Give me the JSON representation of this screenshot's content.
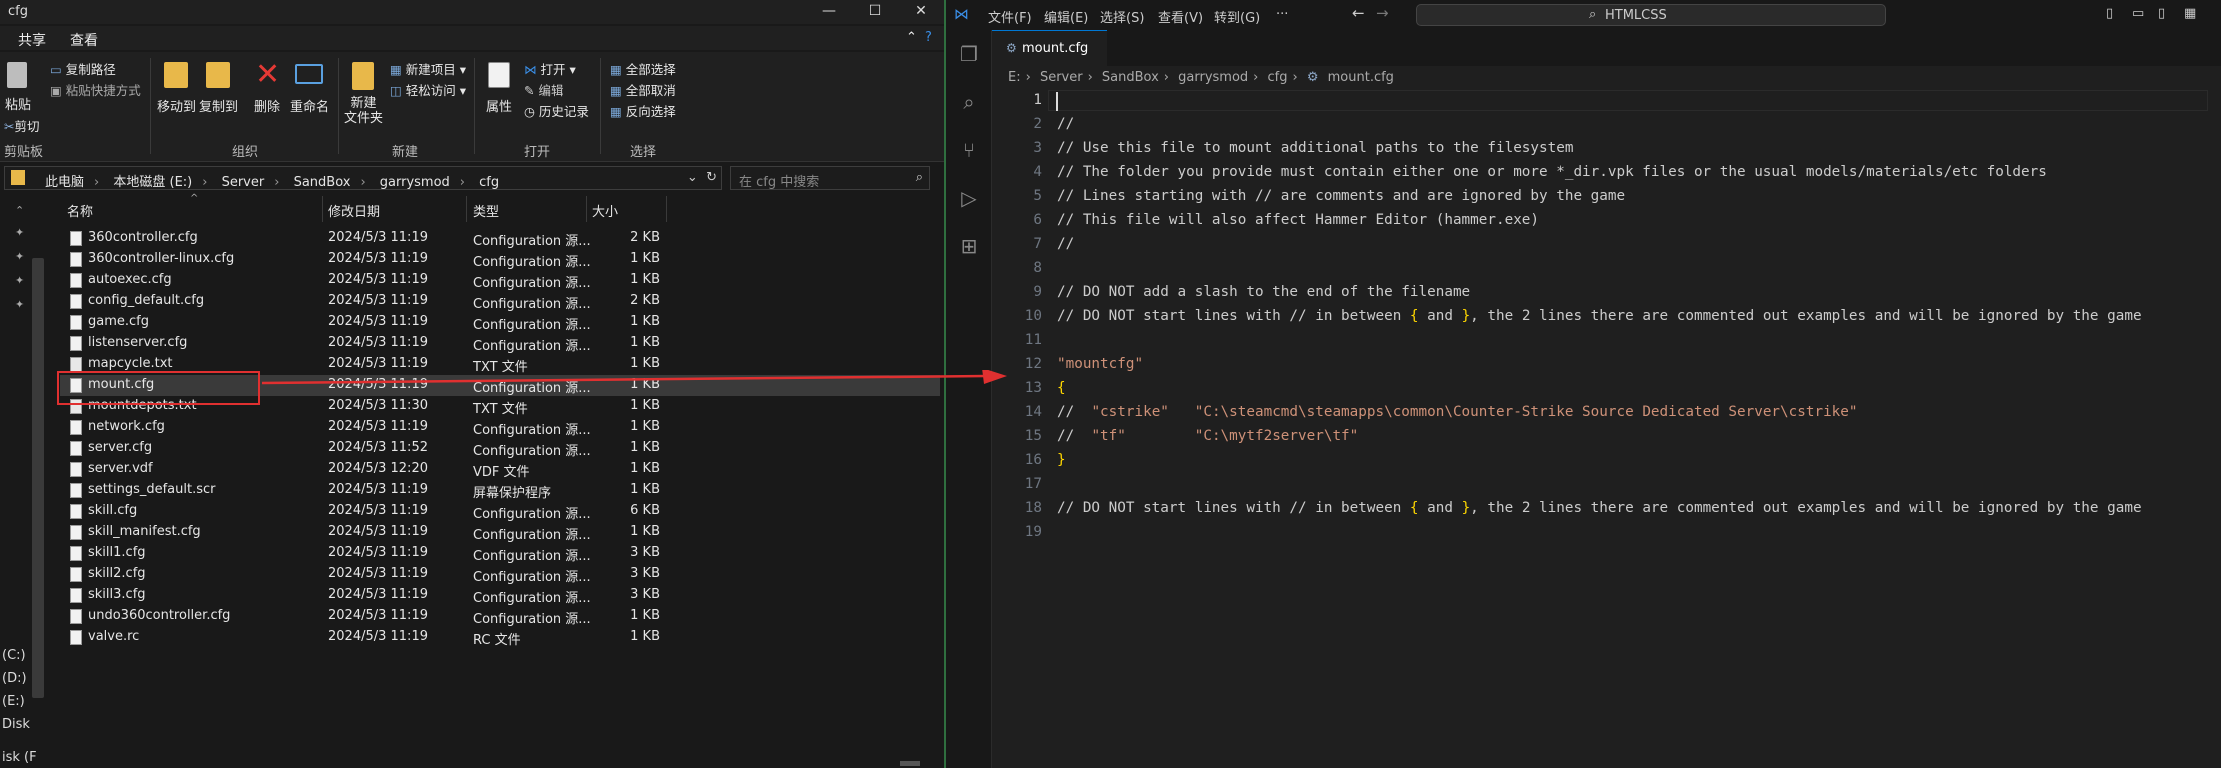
{
  "explorer": {
    "window_title": "cfg",
    "window_buttons": [
      "—",
      "☐",
      "✕"
    ],
    "ribbon_tabs": [
      "共享",
      "查看"
    ],
    "ribbon": {
      "clipboard": {
        "paste": "粘贴",
        "copy_path": "复制路径",
        "paste_shortcut": "粘贴快捷方式",
        "cut": "剪切",
        "group": "剪贴板"
      },
      "organize": {
        "move_to": "移动到",
        "copy_to": "复制到",
        "delete": "删除",
        "rename": "重命名",
        "group": "组织"
      },
      "new": {
        "new_folder": "新建\n文件夹",
        "new_item": "新建项目",
        "easy_access": "轻松访问",
        "group": "新建"
      },
      "open": {
        "properties": "属性",
        "open": "打开",
        "edit": "编辑",
        "history": "历史记录",
        "group": "打开"
      },
      "select": {
        "select_all": "全部选择",
        "select_none": "全部取消",
        "invert": "反向选择",
        "group": "选择"
      }
    },
    "address": {
      "crumbs": [
        "此电脑",
        "本地磁盘 (E:)",
        "Server",
        "SandBox",
        "garrysmod",
        "cfg"
      ],
      "search_placeholder": "在 cfg 中搜索"
    },
    "nav_drives": [
      "(C:)",
      "(D:)",
      "(E:)",
      "Disk",
      "isk (F"
    ],
    "columns": {
      "name": "名称",
      "date": "修改日期",
      "type": "类型",
      "size": "大小"
    },
    "files": [
      {
        "name": "360controller.cfg",
        "date": "2024/5/3 11:19",
        "type": "Configuration 源...",
        "size": "2 KB"
      },
      {
        "name": "360controller-linux.cfg",
        "date": "2024/5/3 11:19",
        "type": "Configuration 源...",
        "size": "1 KB"
      },
      {
        "name": "autoexec.cfg",
        "date": "2024/5/3 11:19",
        "type": "Configuration 源...",
        "size": "1 KB"
      },
      {
        "name": "config_default.cfg",
        "date": "2024/5/3 11:19",
        "type": "Configuration 源...",
        "size": "2 KB"
      },
      {
        "name": "game.cfg",
        "date": "2024/5/3 11:19",
        "type": "Configuration 源...",
        "size": "1 KB"
      },
      {
        "name": "listenserver.cfg",
        "date": "2024/5/3 11:19",
        "type": "Configuration 源...",
        "size": "1 KB"
      },
      {
        "name": "mapcycle.txt",
        "date": "2024/5/3 11:19",
        "type": "TXT 文件",
        "size": "1 KB"
      },
      {
        "name": "mount.cfg",
        "date": "2024/5/3 11:19",
        "type": "Configuration 源...",
        "size": "1 KB"
      },
      {
        "name": "mountdepots.txt",
        "date": "2024/5/3 11:30",
        "type": "TXT 文件",
        "size": "1 KB"
      },
      {
        "name": "network.cfg",
        "date": "2024/5/3 11:19",
        "type": "Configuration 源...",
        "size": "1 KB"
      },
      {
        "name": "server.cfg",
        "date": "2024/5/3 11:52",
        "type": "Configuration 源...",
        "size": "1 KB"
      },
      {
        "name": "server.vdf",
        "date": "2024/5/3 12:20",
        "type": "VDF 文件",
        "size": "1 KB"
      },
      {
        "name": "settings_default.scr",
        "date": "2024/5/3 11:19",
        "type": "屏幕保护程序",
        "size": "1 KB"
      },
      {
        "name": "skill.cfg",
        "date": "2024/5/3 11:19",
        "type": "Configuration 源...",
        "size": "6 KB"
      },
      {
        "name": "skill_manifest.cfg",
        "date": "2024/5/3 11:19",
        "type": "Configuration 源...",
        "size": "1 KB"
      },
      {
        "name": "skill1.cfg",
        "date": "2024/5/3 11:19",
        "type": "Configuration 源...",
        "size": "3 KB"
      },
      {
        "name": "skill2.cfg",
        "date": "2024/5/3 11:19",
        "type": "Configuration 源...",
        "size": "3 KB"
      },
      {
        "name": "skill3.cfg",
        "date": "2024/5/3 11:19",
        "type": "Configuration 源...",
        "size": "3 KB"
      },
      {
        "name": "undo360controller.cfg",
        "date": "2024/5/3 11:19",
        "type": "Configuration 源...",
        "size": "1 KB"
      },
      {
        "name": "valve.rc",
        "date": "2024/5/3 11:19",
        "type": "RC 文件",
        "size": "1 KB"
      }
    ],
    "highlight_color": "#e03030"
  },
  "vscode": {
    "menus": [
      "文件(F)",
      "编辑(E)",
      "选择(S)",
      "查看(V)",
      "转到(G)",
      "···"
    ],
    "nav_arrows": [
      "←",
      "→"
    ],
    "search_label": "HTMLCSS",
    "tab": {
      "label": "mount.cfg",
      "icon": "gear-icon"
    },
    "breadcrumb": [
      "E:",
      "Server",
      "SandBox",
      "garrysmod",
      "cfg",
      "mount.cfg"
    ],
    "accent_color": "#0078d4",
    "lines": [
      {
        "n": "1",
        "text": "",
        "kind": "plain"
      },
      {
        "n": "2",
        "text": "//",
        "kind": "plain"
      },
      {
        "n": "3",
        "text": "// Use this file to mount additional paths to the filesystem",
        "kind": "plain"
      },
      {
        "n": "4",
        "text": "// The folder you provide must contain either one or more *_dir.vpk files or the usual models/materials/etc folders",
        "kind": "plain"
      },
      {
        "n": "5",
        "text": "// Lines starting with // are comments and are ignored by the game",
        "kind": "plain"
      },
      {
        "n": "6",
        "text": "// This file will also affect Hammer Editor (hammer.exe)",
        "kind": "plain"
      },
      {
        "n": "7",
        "text": "//",
        "kind": "plain"
      },
      {
        "n": "8",
        "text": "",
        "kind": "plain"
      },
      {
        "n": "9",
        "text": "// DO NOT add a slash to the end of the filename",
        "kind": "plain"
      },
      {
        "n": "10",
        "text": "// DO NOT start lines with // in between { and }, the 2 lines there are commented out examples and will be ignored by the game",
        "kind": "plain"
      },
      {
        "n": "11",
        "text": "",
        "kind": "plain"
      },
      {
        "n": "12",
        "text": "\"mountcfg\"",
        "kind": "str"
      },
      {
        "n": "13",
        "text": "{",
        "kind": "brace"
      },
      {
        "n": "14",
        "text": "//  \"cstrike\"   \"C:\\steamcmd\\steamapps\\common\\Counter-Strike Source Dedicated Server\\cstrike\"",
        "kind": "mixed"
      },
      {
        "n": "15",
        "text": "//  \"tf\"        \"C:\\mytf2server\\tf\"",
        "kind": "mixed"
      },
      {
        "n": "16",
        "text": "}",
        "kind": "brace"
      },
      {
        "n": "17",
        "text": "",
        "kind": "plain"
      },
      {
        "n": "18",
        "text": "// DO NOT start lines with // in between { and }, the 2 lines there are commented out examples and will be ignored by the game",
        "kind": "plain"
      },
      {
        "n": "19",
        "text": "",
        "kind": "plain"
      }
    ]
  }
}
